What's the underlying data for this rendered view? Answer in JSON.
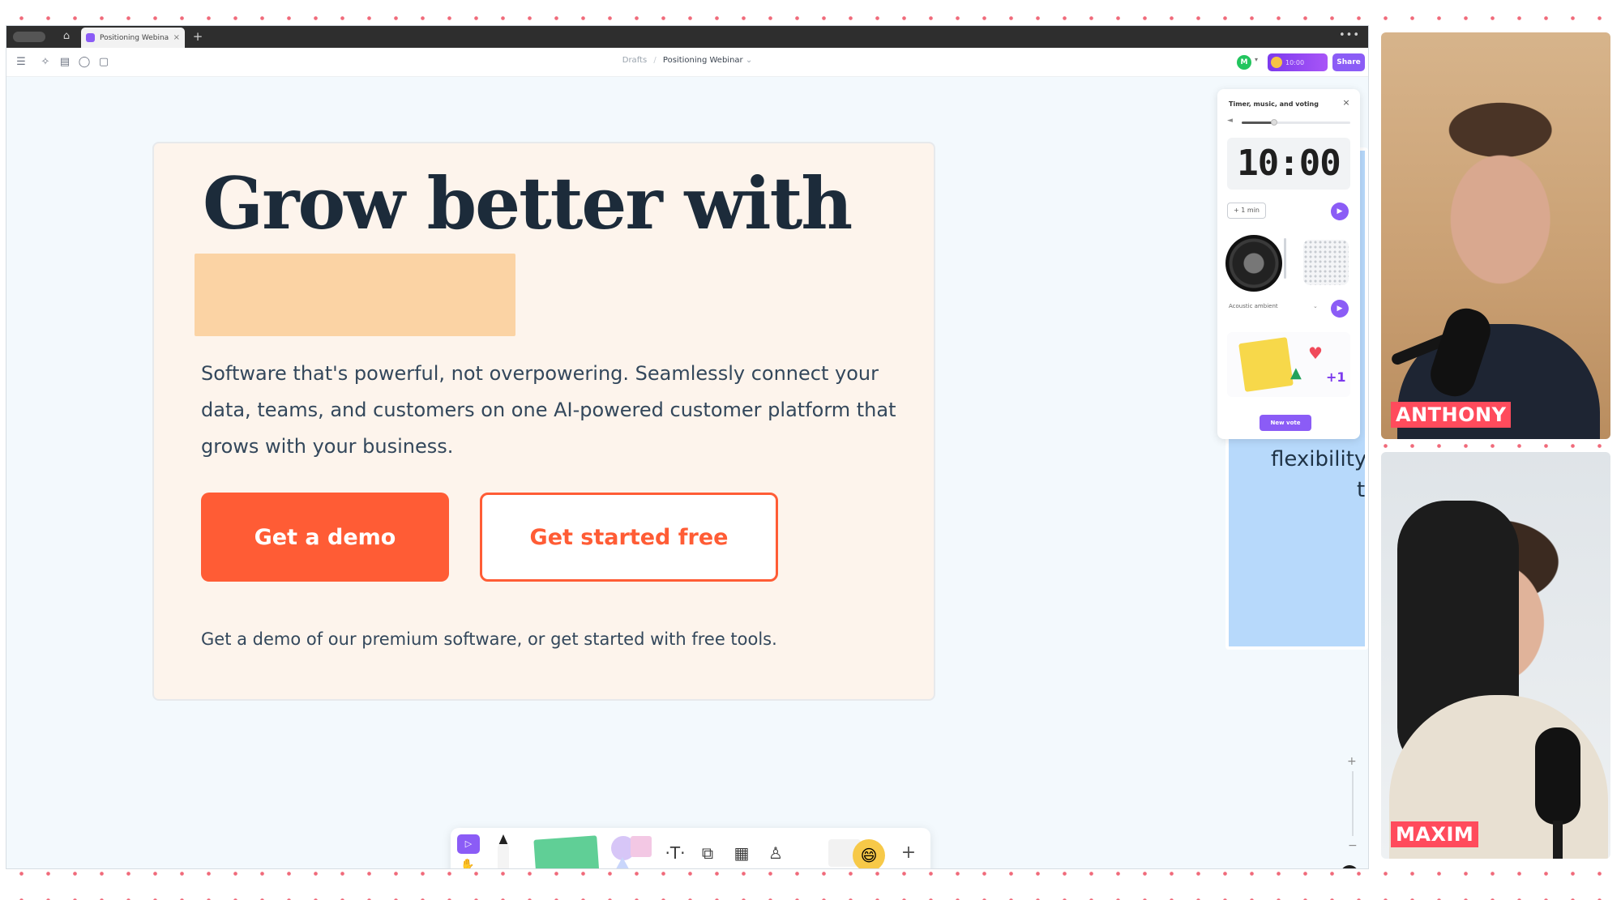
{
  "browser": {
    "tab_title": "Positioning Webinar",
    "tab_close": "×",
    "new_tab": "+",
    "more": "•••"
  },
  "toolbar": {
    "breadcrumb_root": "Drafts",
    "breadcrumb_sep": "/",
    "board_title": "Positioning Webinar",
    "board_caret": "⌄",
    "avatar_initial": "M",
    "timer_pill": "10:00",
    "share_label": "Share"
  },
  "hero": {
    "title": "Grow better with",
    "description": "Software that's powerful, not overpowering. Seamlessly connect your data, teams, and customers on one AI-powered customer platform that grows with your business.",
    "primary_button": "Get a demo",
    "secondary_button": "Get started free",
    "note": "Get a demo of our premium software, or get started with free tools."
  },
  "blue_card": {
    "line1": "flexibility a",
    "line2": "th"
  },
  "panel": {
    "title": "Timer, music, and voting",
    "close": "×",
    "volume_fraction": 0.3,
    "timer": "10:00",
    "add_min": "+ 1 min",
    "play": "▶",
    "music_track": "Acoustic ambient",
    "music_caret": "⌄",
    "new_vote": "New vote"
  },
  "bottom_toolbar": {
    "text_tool": "·T·",
    "frame_tool": "⧉",
    "table_tool": "▦",
    "stamp_tool": "♙",
    "emoji": "😄",
    "more": "+"
  },
  "zoom": {
    "plus": "+",
    "minus": "−",
    "help": "?"
  },
  "participants": [
    {
      "name": "ANTHONY"
    },
    {
      "name": "MAXIM"
    }
  ],
  "colors": {
    "hubspot_orange": "#ff5c35",
    "highlight": "#fbd3a4",
    "accent_purple": "#8b5cf6",
    "name_tag": "#ff4b5c",
    "dot_border": "#f06a7a"
  }
}
